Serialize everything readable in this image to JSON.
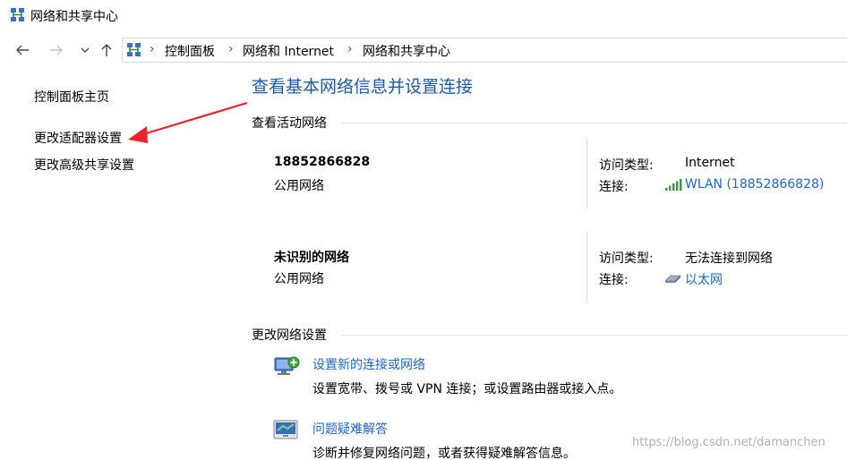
{
  "window": {
    "title": "网络和共享中心",
    "icon": "network-center-icon"
  },
  "nav": {
    "back_icon": "arrow-left-icon",
    "forward_icon": "arrow-right-icon",
    "recent_icon": "chevron-down-icon",
    "up_icon": "arrow-up-icon"
  },
  "address": {
    "icon": "network-center-icon",
    "separator": "›",
    "crumbs": [
      "控制面板",
      "网络和 Internet",
      "网络和共享中心"
    ]
  },
  "sidebar": {
    "items": [
      {
        "label": "控制面板主页"
      },
      {
        "label": "更改适配器设置"
      },
      {
        "label": "更改高级共享设置"
      }
    ]
  },
  "main": {
    "title": "查看基本网络信息并设置连接",
    "active_networks_heading": "查看活动网络",
    "networks": [
      {
        "name": "18852866828",
        "type": "公用网络",
        "access_type_label": "访问类型:",
        "access_type_value": "Internet",
        "connection_label": "连接:",
        "connection_value": "WLAN (18852866828)",
        "connection_icon": "wifi-signal-icon"
      },
      {
        "name": "未识别的网络",
        "type": "公用网络",
        "access_type_label": "访问类型:",
        "access_type_value": "无法连接到网络",
        "connection_label": "连接:",
        "connection_value": "以太网",
        "connection_icon": "ethernet-icon"
      }
    ],
    "change_settings_heading": "更改网络设置",
    "tasks": [
      {
        "link": "设置新的连接或网络",
        "description": "设置宽带、拨号或 VPN 连接；或设置路由器或接入点。",
        "icon": "new-connection-icon"
      },
      {
        "link": "问题疑难解答",
        "description": "诊断并修复网络问题，或者获得疑难解答信息。",
        "icon": "troubleshoot-icon"
      }
    ]
  },
  "annotation": {
    "color": "#e8252b"
  },
  "colors": {
    "link": "#1e66c7",
    "title": "#1e5aa8"
  },
  "watermark": "https://blog.csdn.net/damanchen"
}
